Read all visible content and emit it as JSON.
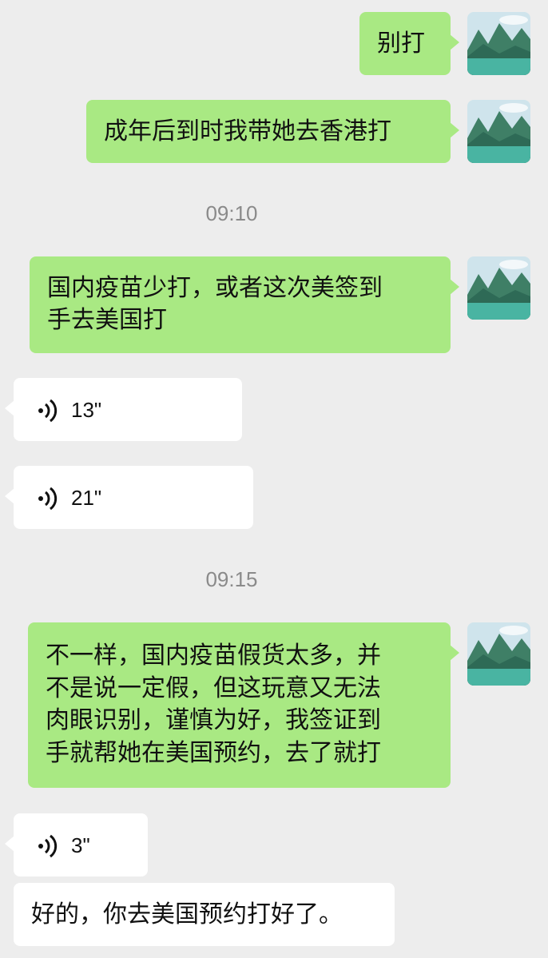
{
  "messages": [
    {
      "type": "text",
      "from": "me",
      "text": "别打"
    },
    {
      "type": "text",
      "from": "me",
      "text": "成年后到时我带她去香港打"
    },
    {
      "type": "timestamp",
      "time": "09:10"
    },
    {
      "type": "text",
      "from": "me",
      "text": "国内疫苗少打，或者这次美签到\n手去美国打"
    },
    {
      "type": "voice",
      "from": "other",
      "duration": "13\""
    },
    {
      "type": "voice",
      "from": "other",
      "duration": "21\""
    },
    {
      "type": "timestamp",
      "time": "09:15"
    },
    {
      "type": "text",
      "from": "me",
      "text": "不一样，国内疫苗假货太多，并\n不是说一定假，但这玩意又无法\n肉眼识别，谨慎为好，我签证到\n手就帮她在美国预约，去了就打"
    },
    {
      "type": "voice",
      "from": "other",
      "duration": "3\""
    },
    {
      "type": "text",
      "from": "other",
      "text": "好的，你去美国预约打好了。"
    }
  ],
  "colors": {
    "background": "#ededed",
    "outgoing_bubble": "#a9e983",
    "incoming_bubble": "#ffffff",
    "timestamp": "#8a8a8a"
  },
  "avatar_icon": "landscape-avatar-icon",
  "voice_icon": "voice-wave-icon"
}
